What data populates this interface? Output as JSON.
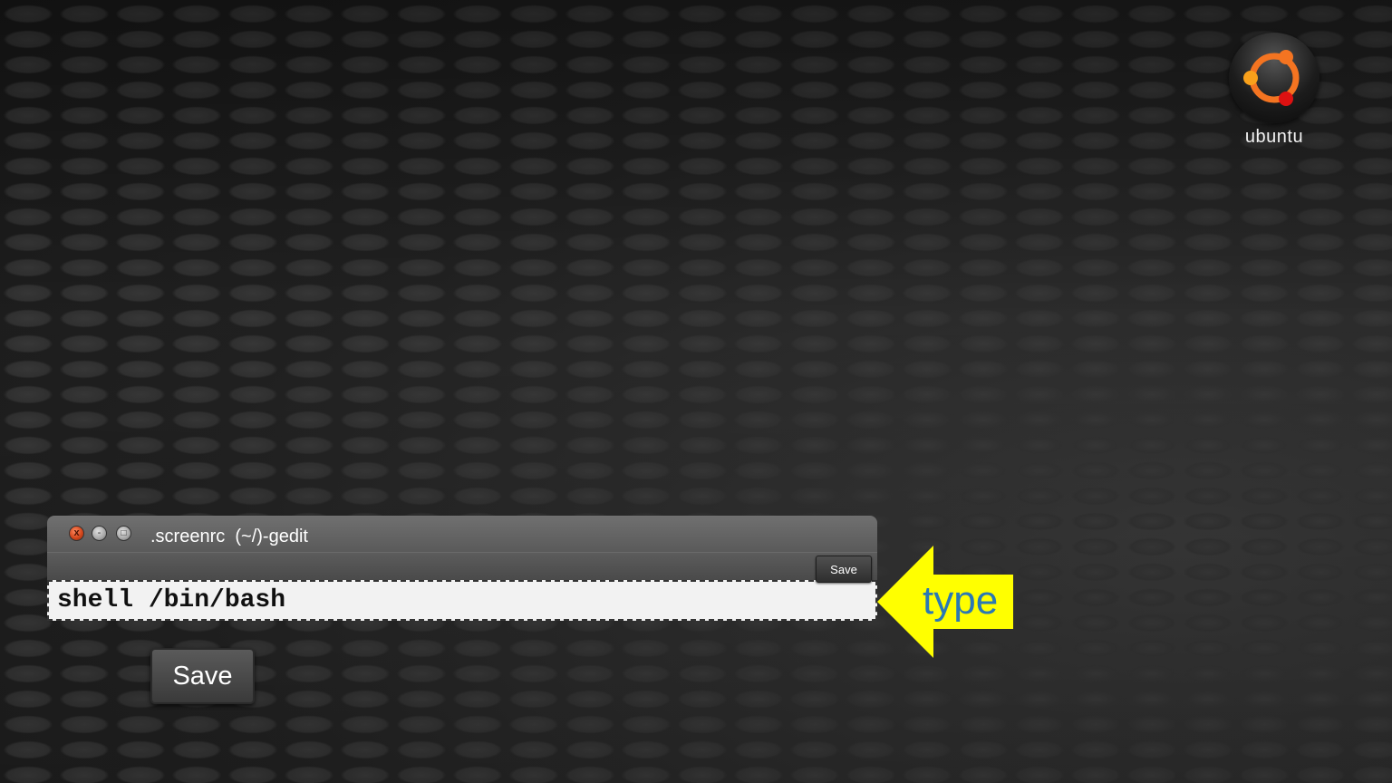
{
  "desktop": {
    "logo_text": "ubuntu"
  },
  "window": {
    "title": ".screenrc  (~/)-gedit",
    "close_glyph": "x",
    "minimize_glyph": "-",
    "maximize_glyph": "□",
    "toolbar_save_label": "Save",
    "editor_text": "shell /bin/bash"
  },
  "save_button": {
    "label": "Save"
  },
  "callout": {
    "label": "type"
  },
  "colors": {
    "arrow_fill": "#ffff00",
    "callout_text": "#2a78b4",
    "close_button": "#d4471c",
    "editor_bg": "#f2f2f2",
    "logo_orange": "#f47421",
    "logo_red": "#dd1111"
  },
  "icons": {
    "logo": "ubuntu-logo-icon",
    "arrow": "left-arrow-icon"
  }
}
